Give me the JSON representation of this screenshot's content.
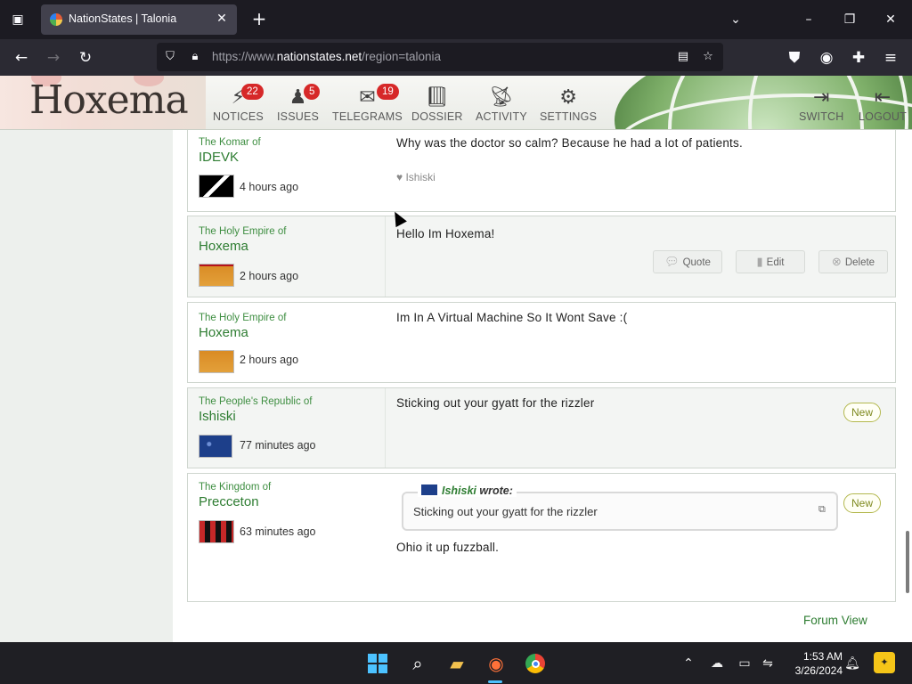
{
  "browser": {
    "tab_title": "NationStates | Talonia",
    "url_prefix": "https://www.",
    "url_domain": "nationstates.net",
    "url_path": "/region=talonia"
  },
  "site": {
    "banner_title": "Hoxema",
    "menu": [
      {
        "label": "NOTICES",
        "icon": "lightning-icon",
        "badge": "22"
      },
      {
        "label": "ISSUES",
        "icon": "person-icon",
        "badge": "5"
      },
      {
        "label": "TELEGRAMS",
        "icon": "envelope-icon",
        "badge": "19"
      },
      {
        "label": "DOSSIER",
        "icon": "book-icon"
      },
      {
        "label": "ACTIVITY",
        "icon": "satellite-dish-icon"
      },
      {
        "label": "SETTINGS",
        "icon": "gears-icon"
      }
    ],
    "right_menu": [
      {
        "label": "SWITCH",
        "icon": "sign-in-icon"
      },
      {
        "label": "LOGOUT",
        "icon": "sign-out-icon"
      }
    ]
  },
  "posts": [
    {
      "pretitle": "The Komar of",
      "nation": "IDEVK",
      "time": "4 hours ago",
      "message": "Why was the doctor so calm? Because he had a lot of patients.",
      "like": "Ishiski"
    },
    {
      "pretitle": "The Holy Empire of",
      "nation": "Hoxema",
      "time": "2 hours ago",
      "message": "Hello Im Hoxema!",
      "buttons": {
        "quote": "Quote",
        "edit": "Edit",
        "delete": "Delete"
      }
    },
    {
      "pretitle": "The Holy Empire of",
      "nation": "Hoxema",
      "time": "2 hours ago",
      "message": "Im In A Virtual Machine So It Wont Save :("
    },
    {
      "pretitle": "The People's Republic of",
      "nation": "Ishiski",
      "time": "77 minutes ago",
      "message": "Sticking out your gyatt for the rizzler",
      "badge": "New"
    },
    {
      "pretitle": "The Kingdom of",
      "nation": "Precceton",
      "time": "63 minutes ago",
      "quote_author": "Ishiski",
      "quote_suffix": "wrote:",
      "quote_text": "Sticking out your gyatt for the rizzler",
      "message": "Ohio it up fuzzball.",
      "badge": "New"
    }
  ],
  "forum_view": "Forum View",
  "taskbar": {
    "time": "1:53 AM",
    "date": "3/26/2024"
  },
  "colors": {
    "nation_green": "#2e7d32",
    "badge_red": "#d62828",
    "browser_dark": "#1c1b22"
  }
}
